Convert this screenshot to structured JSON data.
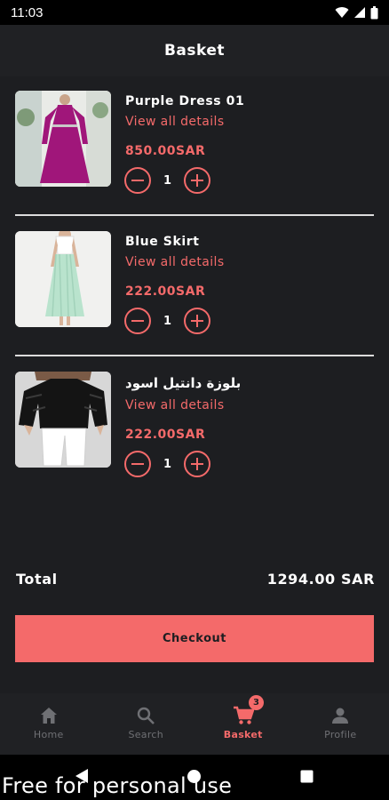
{
  "status_bar": {
    "time": "11:03"
  },
  "header": {
    "title": "Basket"
  },
  "items": [
    {
      "name": "Purple Dress 01",
      "details_link": "View all details",
      "price": "850.00SAR",
      "quantity": "1"
    },
    {
      "name": "Blue Skirt",
      "details_link": "View all details",
      "price": "222.00SAR",
      "quantity": "1"
    },
    {
      "name": "بلوزة دانتيل اسود",
      "details_link": "View all details",
      "price": "222.00SAR",
      "quantity": "1"
    }
  ],
  "total": {
    "label": "Total",
    "value": "1294.00 SAR"
  },
  "checkout": {
    "label": "Checkout"
  },
  "nav": {
    "items": [
      {
        "label": "Home",
        "icon": "home-icon"
      },
      {
        "label": "Search",
        "icon": "search-icon"
      },
      {
        "label": "Basket",
        "icon": "cart-icon",
        "badge": "3",
        "active": true
      },
      {
        "label": "Profile",
        "icon": "person-icon"
      }
    ]
  },
  "watermark": "Free for personal use",
  "colors": {
    "accent": "#f46a6a",
    "background": "#1d1e21",
    "surface": "#202124",
    "inactive": "#6f7074"
  }
}
